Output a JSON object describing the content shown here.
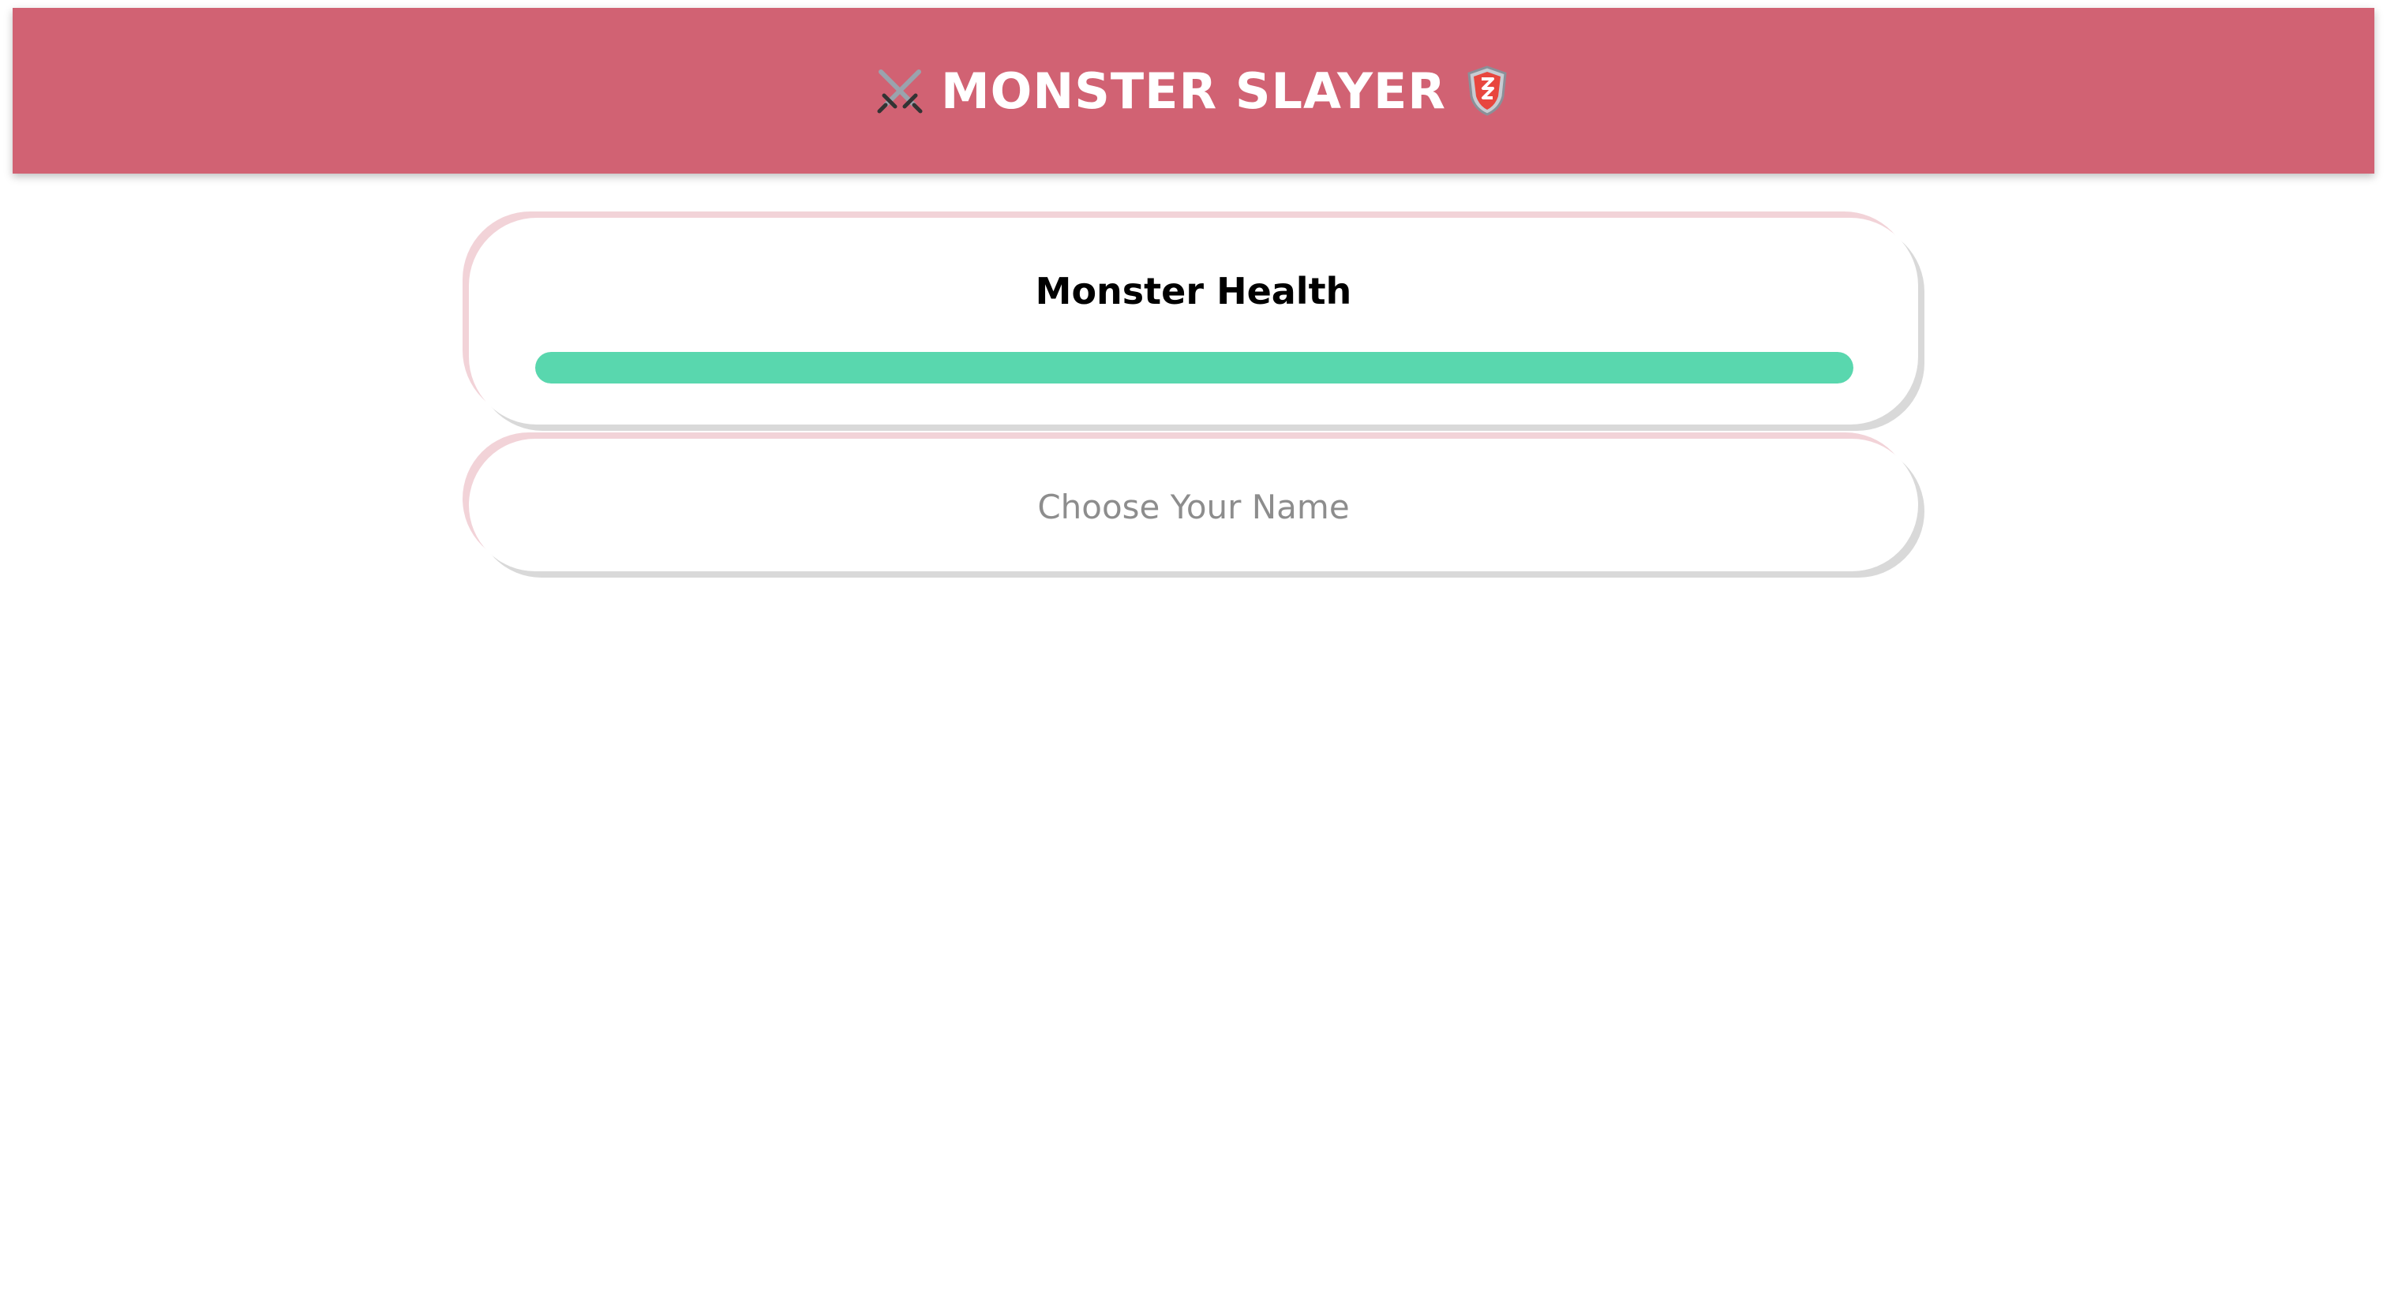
{
  "header": {
    "title": "MONSTER SLAYER",
    "left_icon": "crossed-swords-icon",
    "right_icon": "shield-icon",
    "background_color": "#d16273"
  },
  "monster": {
    "health_label": "Monster Health",
    "health_percent": 100,
    "bar_color": "#59d7ae"
  },
  "player": {
    "name_placeholder": "Choose Your Name",
    "name_value": ""
  }
}
